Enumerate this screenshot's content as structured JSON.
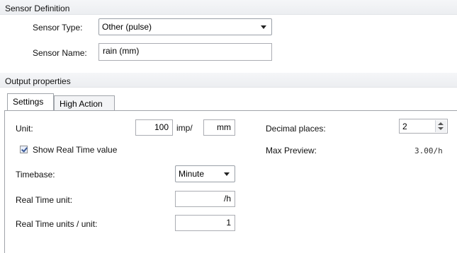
{
  "sensor_definition": {
    "title": "Sensor Definition",
    "sensor_type_label": "Sensor Type:",
    "sensor_type_value": "Other (pulse)",
    "sensor_name_label": "Sensor Name:",
    "sensor_name_value": "rain (mm)"
  },
  "output_properties": {
    "title": "Output properties",
    "tabs": [
      {
        "label": "Settings",
        "active": true
      },
      {
        "label": "High Action",
        "active": false
      }
    ]
  },
  "settings": {
    "unit_label": "Unit:",
    "unit_imp_value": "100",
    "imp_label": "imp/",
    "unit_value": "mm",
    "show_realtime_label": "Show Real Time value",
    "show_realtime_checked": true,
    "timebase_label": "Timebase:",
    "timebase_value": "Minute",
    "realtime_unit_label": "Real Time unit:",
    "realtime_unit_value": "/h",
    "realtime_units_per_unit_label": "Real Time units / unit:",
    "realtime_units_per_unit_value": "1",
    "decimal_places_label": "Decimal places:",
    "decimal_places_value": "2",
    "max_preview_label": "Max Preview:",
    "max_preview_value": "3.00/h"
  },
  "colors": {
    "header_bg": "#eceef1",
    "checkbox_check": "#3b5a97"
  }
}
